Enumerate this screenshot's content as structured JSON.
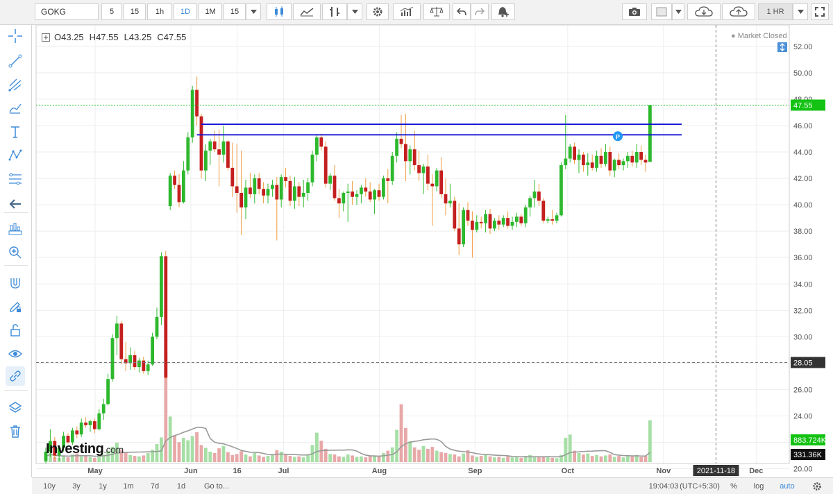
{
  "toolbar": {
    "symbol": "GOKG",
    "intervals": [
      "5",
      "15",
      "1h",
      "1D",
      "1M"
    ],
    "active_interval": "1D",
    "interval_select": "15",
    "timeframe": "1 HR"
  },
  "legend": {
    "open_label": "O",
    "open": "43.25",
    "high_label": "H",
    "high": "47.55",
    "low_label": "L",
    "low": "43.25",
    "close_label": "C",
    "close": "47.55"
  },
  "status": "Market Closed",
  "brand": {
    "name": "Investing",
    "suffix": ".com"
  },
  "bottom": {
    "ranges": [
      "10y",
      "3y",
      "1y",
      "1m",
      "7d",
      "1d"
    ],
    "goto": "Go to...",
    "time": "19:04:03",
    "tz": "(UTC+5:30)",
    "percent": "%",
    "log": "log",
    "auto": "auto"
  },
  "colors": {
    "up": "#2db82d",
    "down": "#c41f1f",
    "wick_down": "#f09a3a",
    "volume_up": "#a6dfa6",
    "volume_down": "#e8a8a8",
    "hline": "#1414d8",
    "last_price": "#13c213",
    "accent": "#3d8bd9"
  },
  "chart_data": {
    "type": "candlestick",
    "symbol": "GOKG",
    "ylim": [
      20.4,
      53.2
    ],
    "y_ticks": [
      "52.00",
      "50.00",
      "48.00",
      "46.00",
      "44.00",
      "42.00",
      "40.00",
      "38.00",
      "36.00",
      "34.00",
      "32.00",
      "30.00",
      "28.00",
      "26.00",
      "24.00",
      "22.00",
      "20.00"
    ],
    "x_ticks": [
      {
        "label": "May",
        "date": "2021-05-01"
      },
      {
        "label": "Jun",
        "date": "2021-06-01"
      },
      {
        "label": "16",
        "date": "2021-06-16"
      },
      {
        "label": "Jul",
        "date": "2021-07-01"
      },
      {
        "label": "Aug",
        "date": "2021-08-01"
      },
      {
        "label": "Sep",
        "date": "2021-09-01"
      },
      {
        "label": "Oct",
        "date": "2021-10-01"
      },
      {
        "label": "Nov",
        "date": "2021-11-01"
      },
      {
        "label": "2021-11-18",
        "date": "2021-11-18"
      },
      {
        "label": "Dec",
        "date": "2021-12-01"
      }
    ],
    "last_price": "47.55",
    "crosshair_price": "28.05",
    "crosshair_date": "2021-11-18",
    "volume_last": "883.724K",
    "volume_avg": "331.36K",
    "horizontal_lines": [
      46.1,
      45.3
    ],
    "candles": [
      [
        20.6,
        21.6,
        20.4,
        21.3
      ],
      [
        21.3,
        23.0,
        20.9,
        22.1
      ],
      [
        22.1,
        22.4,
        20.7,
        21.0
      ],
      [
        21.0,
        21.8,
        20.6,
        21.6
      ],
      [
        21.6,
        22.8,
        21.3,
        22.5
      ],
      [
        22.5,
        22.7,
        21.9,
        22.0
      ],
      [
        22.0,
        23.1,
        21.8,
        22.9
      ],
      [
        22.9,
        23.2,
        22.3,
        22.6
      ],
      [
        22.6,
        23.8,
        22.4,
        23.5
      ],
      [
        23.5,
        23.9,
        23.1,
        23.3
      ],
      [
        23.3,
        23.7,
        22.8,
        23.6
      ],
      [
        23.6,
        23.8,
        22.7,
        23.0
      ],
      [
        23.0,
        24.5,
        22.9,
        24.2
      ],
      [
        24.2,
        25.3,
        23.7,
        24.9
      ],
      [
        24.9,
        27.2,
        24.8,
        26.8
      ],
      [
        26.8,
        30.2,
        26.6,
        29.9
      ],
      [
        29.9,
        31.6,
        28.6,
        31.0
      ],
      [
        31.0,
        31.2,
        27.9,
        28.3
      ],
      [
        28.3,
        29.6,
        27.4,
        28.0
      ],
      [
        28.0,
        29.2,
        27.5,
        28.6
      ],
      [
        28.6,
        28.9,
        27.5,
        27.7
      ],
      [
        27.7,
        28.4,
        27.3,
        28.2
      ],
      [
        28.2,
        28.5,
        27.2,
        27.4
      ],
      [
        27.4,
        28.2,
        27.1,
        27.9
      ],
      [
        27.9,
        30.3,
        27.8,
        30.0
      ],
      [
        30.0,
        32.2,
        29.8,
        31.5
      ],
      [
        31.5,
        36.4,
        30.9,
        36.1
      ],
      [
        36.1,
        36.5,
        26.8,
        26.9
      ],
      [
        39.9,
        42.4,
        39.6,
        42.2
      ],
      [
        42.2,
        42.6,
        41.2,
        41.5
      ],
      [
        41.5,
        42.3,
        39.8,
        40.2
      ],
      [
        40.2,
        43.3,
        40.1,
        42.6
      ],
      [
        42.6,
        45.5,
        42.3,
        45.1
      ],
      [
        45.1,
        49.0,
        44.7,
        48.7
      ],
      [
        48.7,
        49.7,
        46.0,
        46.7
      ],
      [
        46.7,
        46.9,
        42.0,
        42.6
      ],
      [
        42.6,
        44.6,
        41.8,
        44.1
      ],
      [
        44.1,
        45.0,
        43.0,
        44.8
      ],
      [
        44.8,
        45.6,
        44.0,
        44.2
      ],
      [
        44.2,
        45.7,
        41.4,
        43.8
      ],
      [
        43.8,
        46.0,
        43.2,
        44.8
      ],
      [
        44.8,
        44.9,
        42.6,
        42.8
      ],
      [
        42.8,
        44.7,
        40.6,
        41.4
      ],
      [
        41.4,
        44.6,
        39.4,
        40.9
      ],
      [
        40.9,
        44.1,
        37.7,
        39.8
      ],
      [
        39.8,
        41.9,
        38.9,
        41.3
      ],
      [
        41.3,
        42.4,
        40.5,
        40.8
      ],
      [
        40.8,
        42.3,
        40.1,
        42.0
      ],
      [
        42.0,
        42.4,
        40.8,
        41.2
      ],
      [
        41.2,
        41.7,
        40.1,
        40.7
      ],
      [
        40.7,
        41.6,
        40.1,
        41.2
      ],
      [
        41.2,
        41.9,
        40.6,
        41.5
      ],
      [
        41.5,
        42.1,
        37.3,
        40.4
      ],
      [
        40.4,
        42.3,
        39.8,
        42.1
      ],
      [
        42.1,
        42.8,
        41.3,
        41.8
      ],
      [
        41.8,
        42.2,
        39.9,
        40.3
      ],
      [
        40.3,
        42.1,
        39.7,
        41.4
      ],
      [
        41.4,
        41.7,
        39.9,
        40.6
      ],
      [
        40.6,
        41.9,
        39.8,
        40.9
      ],
      [
        40.9,
        42.0,
        40.3,
        41.7
      ],
      [
        41.7,
        44.1,
        41.4,
        43.8
      ],
      [
        43.8,
        45.3,
        43.3,
        45.1
      ],
      [
        45.1,
        45.4,
        44.1,
        44.4
      ],
      [
        44.4,
        44.8,
        41.3,
        41.6
      ],
      [
        41.6,
        42.4,
        41.1,
        42.2
      ],
      [
        42.2,
        43.0,
        40.3,
        40.5
      ],
      [
        40.5,
        41.2,
        39.0,
        40.1
      ],
      [
        40.1,
        41.0,
        39.5,
        40.9
      ],
      [
        40.9,
        41.6,
        38.7,
        41.0
      ],
      [
        41.0,
        41.8,
        40.0,
        40.6
      ],
      [
        40.6,
        41.1,
        40.0,
        40.8
      ],
      [
        40.8,
        41.5,
        40.1,
        41.3
      ],
      [
        41.3,
        42.0,
        40.6,
        41.0
      ],
      [
        41.0,
        41.7,
        40.2,
        40.4
      ],
      [
        40.4,
        41.2,
        39.3,
        41.1
      ],
      [
        41.1,
        41.6,
        40.3,
        40.6
      ],
      [
        40.6,
        42.2,
        40.4,
        42.0
      ],
      [
        42.0,
        42.7,
        40.1,
        41.8
      ],
      [
        41.8,
        44.0,
        41.5,
        43.7
      ],
      [
        43.7,
        45.5,
        43.2,
        45.0
      ],
      [
        45.0,
        46.8,
        44.3,
        44.6
      ],
      [
        44.6,
        46.9,
        41.8,
        43.3
      ],
      [
        43.3,
        44.5,
        42.3,
        44.2
      ],
      [
        44.2,
        45.6,
        42.6,
        43.0
      ],
      [
        43.0,
        44.1,
        41.8,
        42.4
      ],
      [
        42.4,
        43.1,
        40.8,
        42.9
      ],
      [
        42.9,
        43.8,
        41.1,
        41.6
      ],
      [
        41.6,
        42.3,
        38.4,
        41.4
      ],
      [
        41.4,
        42.8,
        41.0,
        42.6
      ],
      [
        42.6,
        43.6,
        40.5,
        40.8
      ],
      [
        40.8,
        42.0,
        39.2,
        40.1
      ],
      [
        40.1,
        41.6,
        39.8,
        40.3
      ],
      [
        40.3,
        40.6,
        38.0,
        38.2
      ],
      [
        38.2,
        40.1,
        36.2,
        37.0
      ],
      [
        37.0,
        39.8,
        36.8,
        39.6
      ],
      [
        39.6,
        40.2,
        38.4,
        38.8
      ],
      [
        38.8,
        39.5,
        36.0,
        38.1
      ],
      [
        38.1,
        39.2,
        37.9,
        38.7
      ],
      [
        38.7,
        39.1,
        38.2,
        38.6
      ],
      [
        38.6,
        39.6,
        37.9,
        39.3
      ],
      [
        39.3,
        39.7,
        37.8,
        38.2
      ],
      [
        38.2,
        39.0,
        38.0,
        38.8
      ],
      [
        38.8,
        39.2,
        38.1,
        38.5
      ],
      [
        38.5,
        39.2,
        38.3,
        39.0
      ],
      [
        39.0,
        39.5,
        38.2,
        38.4
      ],
      [
        38.4,
        39.1,
        38.1,
        38.7
      ],
      [
        38.7,
        39.4,
        38.3,
        39.1
      ],
      [
        39.1,
        39.3,
        38.4,
        38.6
      ],
      [
        38.6,
        40.0,
        38.3,
        39.8
      ],
      [
        39.8,
        40.7,
        39.1,
        40.5
      ],
      [
        40.5,
        41.9,
        39.8,
        41.0
      ],
      [
        41.0,
        41.6,
        39.9,
        40.3
      ],
      [
        40.3,
        40.5,
        38.6,
        38.8
      ],
      [
        38.8,
        39.1,
        38.6,
        38.9
      ],
      [
        38.9,
        39.6,
        38.5,
        38.8
      ],
      [
        38.8,
        39.4,
        38.6,
        39.2
      ],
      [
        39.2,
        43.2,
        39.1,
        43.0
      ],
      [
        43.0,
        46.8,
        42.7,
        43.5
      ],
      [
        43.5,
        44.6,
        43.2,
        44.4
      ],
      [
        44.4,
        44.7,
        43.1,
        43.4
      ],
      [
        43.4,
        44.2,
        42.4,
        43.8
      ],
      [
        43.8,
        44.0,
        42.5,
        43.0
      ],
      [
        43.0,
        43.9,
        42.2,
        43.2
      ],
      [
        43.2,
        43.8,
        42.6,
        42.8
      ],
      [
        42.8,
        44.1,
        42.5,
        43.7
      ],
      [
        43.7,
        44.3,
        42.8,
        43.1
      ],
      [
        43.1,
        44.6,
        42.9,
        44.0
      ],
      [
        44.0,
        44.4,
        42.2,
        42.6
      ],
      [
        42.6,
        43.5,
        42.1,
        43.4
      ],
      [
        43.4,
        43.9,
        42.7,
        43.0
      ],
      [
        43.0,
        43.5,
        42.6,
        43.3
      ],
      [
        43.3,
        44.0,
        42.8,
        43.7
      ],
      [
        43.7,
        44.1,
        42.9,
        43.2
      ],
      [
        43.2,
        44.6,
        42.8,
        44.0
      ],
      [
        44.0,
        44.5,
        43.0,
        43.4
      ],
      [
        43.4,
        43.8,
        42.5,
        43.2
      ],
      [
        43.25,
        47.55,
        43.25,
        47.55
      ]
    ],
    "volumes": [
      1.2,
      2.0,
      1.1,
      0.9,
      1.3,
      1.0,
      1.6,
      1.8,
      1.2,
      1.4,
      1.1,
      0.9,
      1.3,
      1.6,
      2.4,
      3.2,
      4.1,
      2.6,
      2.0,
      1.5,
      1.3,
      1.2,
      1.4,
      1.9,
      2.6,
      3.8,
      5.2,
      23.4,
      9.6,
      5.6,
      4.2,
      5.1,
      4.6,
      5.5,
      6.3,
      3.6,
      3.0,
      2.2,
      1.9,
      2.9,
      3.4,
      2.1,
      1.5,
      1.7,
      2.3,
      1.6,
      1.2,
      1.9,
      1.4,
      1.1,
      1.3,
      1.5,
      2.5,
      2.2,
      1.6,
      1.3,
      1.1,
      1.2,
      1.0,
      1.5,
      3.6,
      6.2,
      4.5,
      2.8,
      1.7,
      1.6,
      1.2,
      1.1,
      1.6,
      1.4,
      1.1,
      1.2,
      1.0,
      1.3,
      1.4,
      1.2,
      1.9,
      2.4,
      3.1,
      6.8,
      12.2,
      7.2,
      4.4,
      3.1,
      2.6,
      3.4,
      2.8,
      3.2,
      2.4,
      2.1,
      1.9,
      1.7,
      1.6,
      1.2,
      1.8,
      2.5,
      1.4,
      1.1,
      1.3,
      1.6,
      1.2,
      1.0,
      1.1,
      0.9,
      1.2,
      1.0,
      1.1,
      0.9,
      1.3,
      1.5,
      1.2,
      1.0,
      1.1,
      1.2,
      0.9,
      0.8,
      1.5,
      5.1,
      5.8,
      2.4,
      1.9,
      1.6,
      1.8,
      1.3,
      1.5,
      1.2,
      1.4,
      1.6,
      1.1,
      1.3,
      1.0,
      1.4,
      1.2,
      1.5,
      1.1,
      1.3,
      8.8
    ]
  }
}
